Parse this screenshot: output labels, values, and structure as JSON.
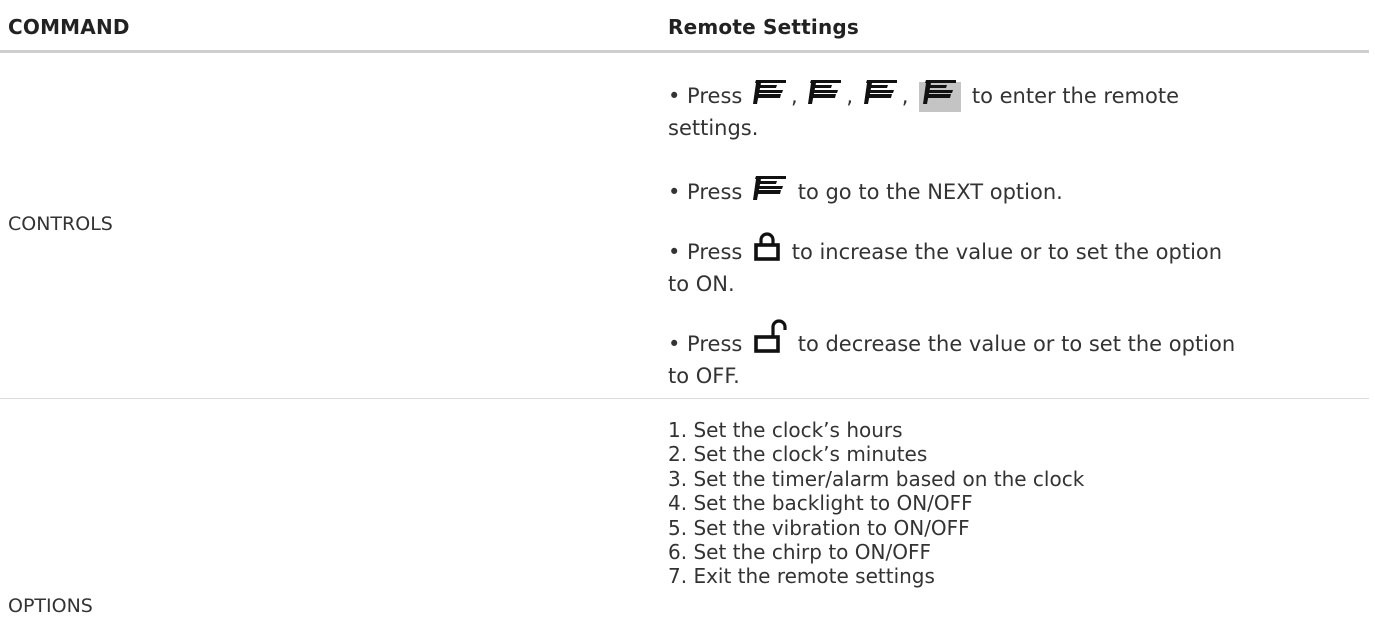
{
  "header": {
    "command": "COMMAND",
    "settings": "Remote Settings"
  },
  "controls": {
    "label": "CONTROLS",
    "bullets": [
      {
        "pre": "• Press",
        "seps": [
          ",",
          ",",
          ","
        ],
        "post": "to enter the remote",
        "wrap": "settings.",
        "icon": "f-button-icon"
      },
      {
        "pre": "• Press",
        "post": "to go to the NEXT option.",
        "icon": "f-button-icon"
      },
      {
        "pre": "• Press",
        "post": "to increase the value or to set the option",
        "wrap": "to ON.",
        "icon": "lock-closed-icon"
      },
      {
        "pre": "• Press",
        "post": "to decrease the value or to set the option",
        "wrap": "to OFF.",
        "icon": "lock-open-icon"
      }
    ]
  },
  "options": {
    "label": "OPTIONS",
    "items": [
      "1. Set the clock’s hours",
      "2. Set the clock’s minutes",
      "3. Set the timer/alarm based on the clock",
      "4. Set the backlight to ON/OFF",
      "5. Set the vibration to ON/OFF",
      "6. Set the chirp to ON/OFF",
      "7. Exit the remote settings"
    ]
  }
}
